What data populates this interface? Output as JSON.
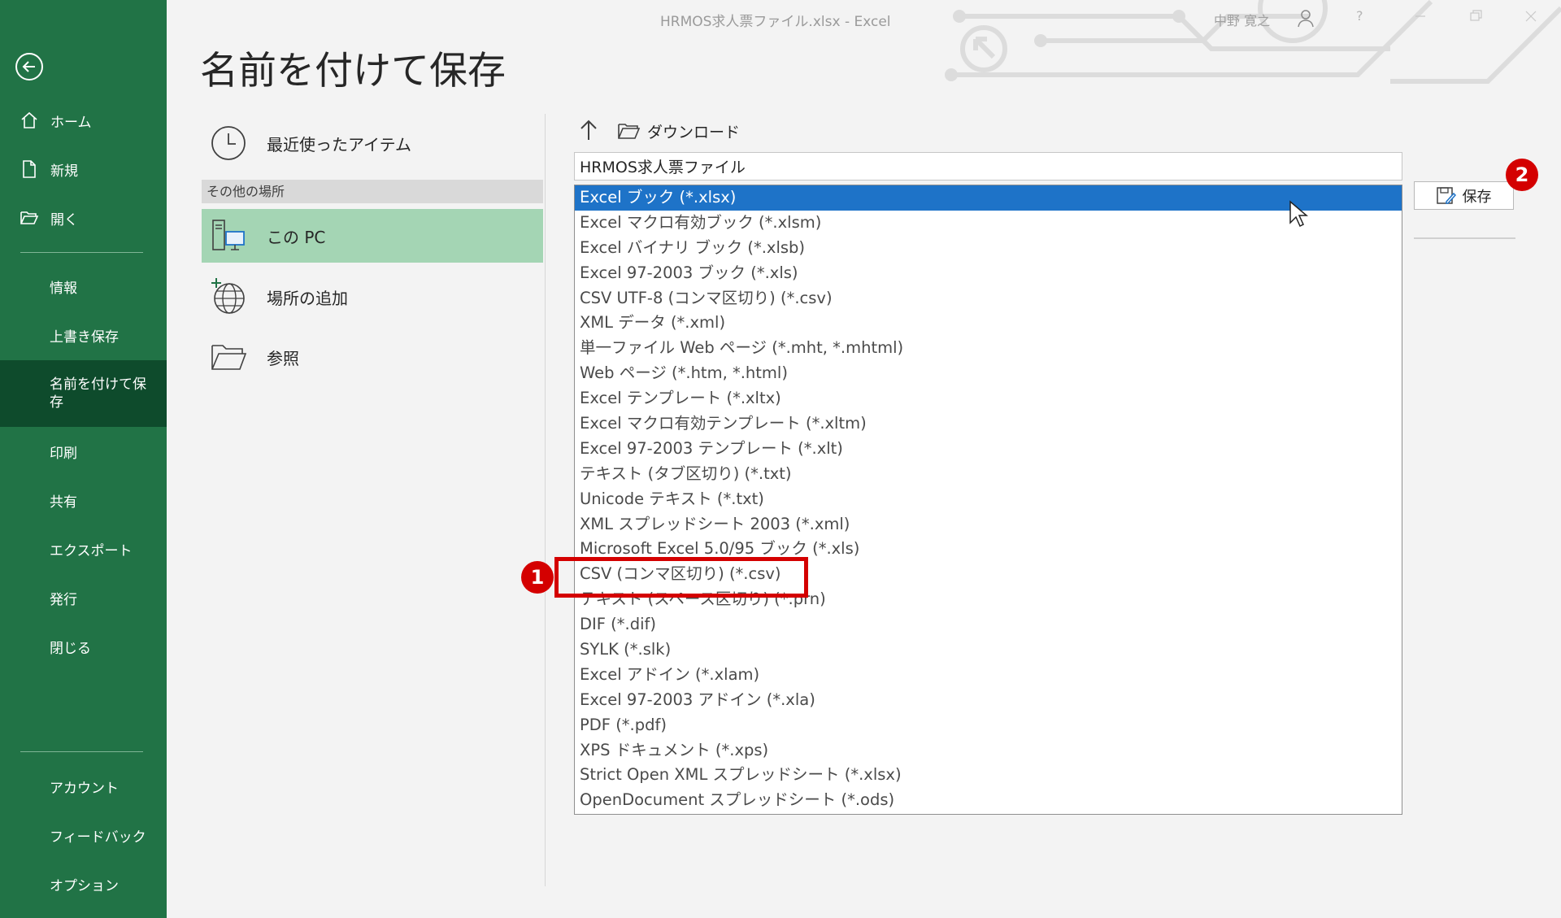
{
  "window": {
    "title": "HRMOS求人票ファイル.xlsx  -  Excel",
    "user_name": "中野 寛之",
    "help": "?"
  },
  "sidebar": {
    "items": [
      {
        "label": "ホーム",
        "icon": "home-icon"
      },
      {
        "label": "新規",
        "icon": "new-document-icon"
      },
      {
        "label": "開く",
        "icon": "open-folder-icon"
      },
      {
        "label": "情報"
      },
      {
        "label": "上書き保存"
      },
      {
        "label": "名前を付けて保存"
      },
      {
        "label": "印刷"
      },
      {
        "label": "共有"
      },
      {
        "label": "エクスポート"
      },
      {
        "label": "発行"
      },
      {
        "label": "閉じる"
      },
      {
        "label": "アカウント"
      },
      {
        "label": "フィードバック"
      },
      {
        "label": "オプション"
      }
    ]
  },
  "page": {
    "title": "名前を付けて保存"
  },
  "locations": {
    "recent": "最近使ったアイテム",
    "other_header": "その他の場所",
    "this_pc": "この PC",
    "add_place": "場所の追加",
    "browse": "参照"
  },
  "save_panel": {
    "folder": "ダウンロード",
    "filename": "HRMOS求人票ファイル",
    "save_label": "保存",
    "file_types": [
      "Excel ブック (*.xlsx)",
      "Excel マクロ有効ブック (*.xlsm)",
      "Excel バイナリ ブック (*.xlsb)",
      "Excel 97-2003 ブック (*.xls)",
      "CSV UTF-8 (コンマ区切り) (*.csv)",
      "XML データ (*.xml)",
      "単一ファイル Web ページ (*.mht, *.mhtml)",
      "Web ページ (*.htm, *.html)",
      "Excel テンプレート (*.xltx)",
      "Excel マクロ有効テンプレート (*.xltm)",
      "Excel 97-2003 テンプレート (*.xlt)",
      "テキスト (タブ区切り) (*.txt)",
      "Unicode テキスト (*.txt)",
      "XML スプレッドシート 2003 (*.xml)",
      "Microsoft Excel 5.0/95 ブック (*.xls)",
      "CSV (コンマ区切り) (*.csv)",
      "テキスト (スペース区切り) (*.prn)",
      "DIF (*.dif)",
      "SYLK (*.slk)",
      "Excel アドイン (*.xlam)",
      "Excel 97-2003 アドイン (*.xla)",
      "PDF (*.pdf)",
      "XPS ドキュメント (*.xps)",
      "Strict Open XML スプレッドシート (*.xlsx)",
      "OpenDocument スプレッドシート (*.ods)"
    ],
    "selected_index": 0
  },
  "annotations": {
    "badge_1": "1",
    "badge_2": "2",
    "color": "#d40000"
  },
  "colors": {
    "sidebar": "#217346",
    "sidebar_active": "#0e4b2c",
    "location_active": "#a4d5b4",
    "selection": "#1e73c8"
  }
}
